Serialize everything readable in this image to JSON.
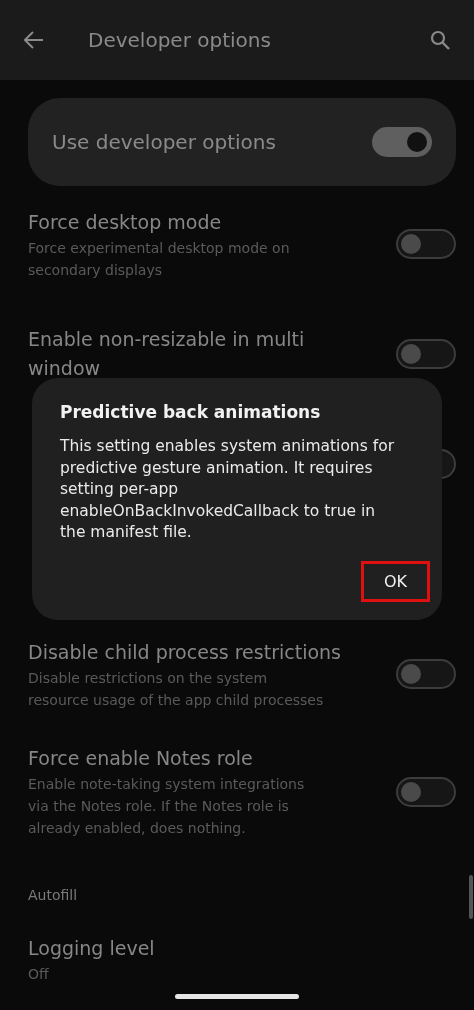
{
  "app_bar": {
    "title": "Developer options"
  },
  "master": {
    "label": "Use developer options",
    "on": true
  },
  "settings": [
    {
      "kind": "toggle",
      "title": "Force desktop mode",
      "summary": "Force experimental desktop mode on secondary displays",
      "on": false
    },
    {
      "kind": "toggle",
      "title": "Enable non-resizable in multi window",
      "on": false
    },
    {
      "kind": "toggle",
      "on": false
    },
    {
      "kind": "blank"
    },
    {
      "kind": "toggle",
      "title": "Disable child process restrictions",
      "summary": "Disable restrictions on the system resource usage of the app child processes",
      "on": false
    },
    {
      "kind": "toggle",
      "title": "Force enable Notes role",
      "summary": "Enable note-taking system integrations via the Notes role. If the Notes role is already enabled, does nothing.",
      "on": false
    },
    {
      "kind": "header",
      "title": "Autofill"
    },
    {
      "kind": "text",
      "title": "Logging level",
      "summary": "Off"
    }
  ],
  "dialog": {
    "title": "Predictive back animations",
    "message": "This setting enables system animations for predictive gesture animation. It requires setting per-app enableOnBackInvokedCallback to true in the manifest file.",
    "button": {
      "label": "OK",
      "highlighted": true
    }
  }
}
